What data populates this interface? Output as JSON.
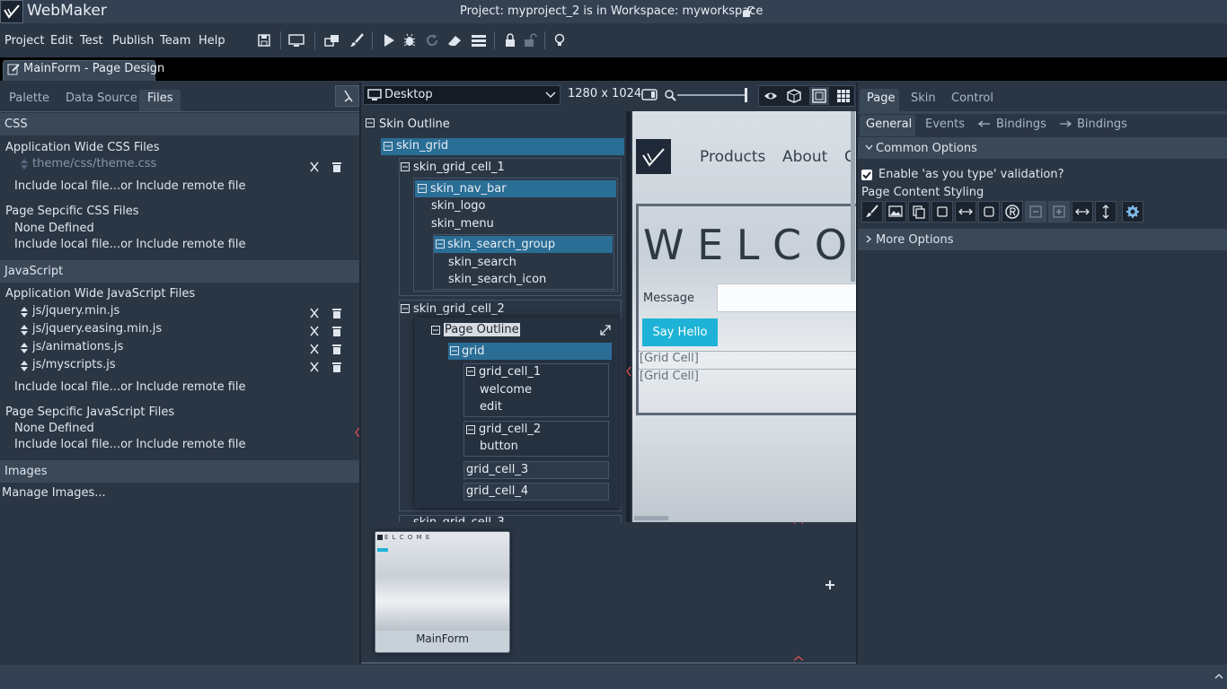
{
  "app": {
    "name": "WebMaker",
    "project_prefix": "Project: ",
    "project_name": "myproject_2",
    "workspace_mid": " is in Workspace: ",
    "workspace_name": "myworkspace"
  },
  "menu": [
    "Project",
    "Edit",
    "Test",
    "Publish",
    "Team",
    "Help"
  ],
  "toolbar_icons": [
    "save-icon",
    "monitor-icon",
    "windows-icon",
    "brush-icon",
    "play-icon",
    "bug-icon",
    "refresh-icon",
    "eraser-icon",
    "server-icon",
    "lock-icon",
    "unlock-icon",
    "lightbulb-icon"
  ],
  "doc_tab": {
    "label": "MainForm - Page Design"
  },
  "left_panel": {
    "tabs": [
      "Palette",
      "Data Source",
      "Files"
    ],
    "active_tab": "Files",
    "css": {
      "header": "CSS",
      "app_wide_title": "Application Wide CSS Files",
      "app_wide_files": [
        "theme/css/theme.css"
      ],
      "include_local": "Include local file...",
      "include_or": "or",
      "include_remote": "Include remote file",
      "page_specific_title": "Page Sepcific CSS Files",
      "page_specific_none": "None Defined"
    },
    "js": {
      "header": "JavaScript",
      "app_wide_title": "Application Wide JavaScript Files",
      "app_wide_files": [
        "js/jquery.min.js",
        "js/jquery.easing.min.js",
        "js/animations.js",
        "js/myscripts.js"
      ],
      "include_local": "Include local file...",
      "include_or": "or",
      "include_remote": "Include remote file",
      "page_specific_title": "Page Sepcific JavaScript Files",
      "page_specific_none": "None Defined"
    },
    "images": {
      "header": "Images",
      "manage": "Manage Images..."
    }
  },
  "design_toolbar": {
    "device": "Desktop",
    "resolution": "1280 x 1024"
  },
  "outline": {
    "skin_outline": "Skin Outline",
    "skin_grid": "skin_grid",
    "skin_grid_cell_1": "skin_grid_cell_1",
    "skin_nav_bar": "skin_nav_bar",
    "skin_logo": "skin_logo",
    "skin_menu": "skin_menu",
    "skin_search_group": "skin_search_group",
    "skin_search": "skin_search",
    "skin_search_icon": "skin_search_icon",
    "skin_grid_cell_2": "skin_grid_cell_2",
    "page_outline": "Page Outline",
    "grid": "grid",
    "grid_cell_1": "grid_cell_1",
    "welcome": "welcome",
    "edit": "edit",
    "grid_cell_2": "grid_cell_2",
    "button": "button",
    "grid_cell_3": "grid_cell_3",
    "grid_cell_4": "grid_cell_4",
    "skin_grid_cell_3": "skin_grid_cell_3"
  },
  "preview": {
    "nav_products": "Products",
    "nav_about": "About",
    "nav_cut": "C",
    "welcome": "W E L C O",
    "message_label": "Message",
    "say_hello": "Say Hello",
    "grid_cell_a": "[Grid Cell]",
    "grid_cell_b": "[Grid Cell]"
  },
  "thumbnails": [
    {
      "label": "MainForm",
      "mini_title": "E L C O M E"
    }
  ],
  "right_panel": {
    "tabs": [
      "Page",
      "Skin",
      "Control"
    ],
    "active_tab": "Page",
    "subtabs": [
      "General",
      "Events",
      "Bindings",
      "Bindings"
    ],
    "active_subtab": "General",
    "common_options": "Common Options",
    "validation_label": "Enable 'as you type' validation?",
    "validation_checked": true,
    "styling_label": "Page Content Styling",
    "more_options": "More Options"
  },
  "colors": {
    "accent_blue": "#2a6e96",
    "button_cyan": "#1eb3d6",
    "panel_bg": "#2b3645"
  }
}
